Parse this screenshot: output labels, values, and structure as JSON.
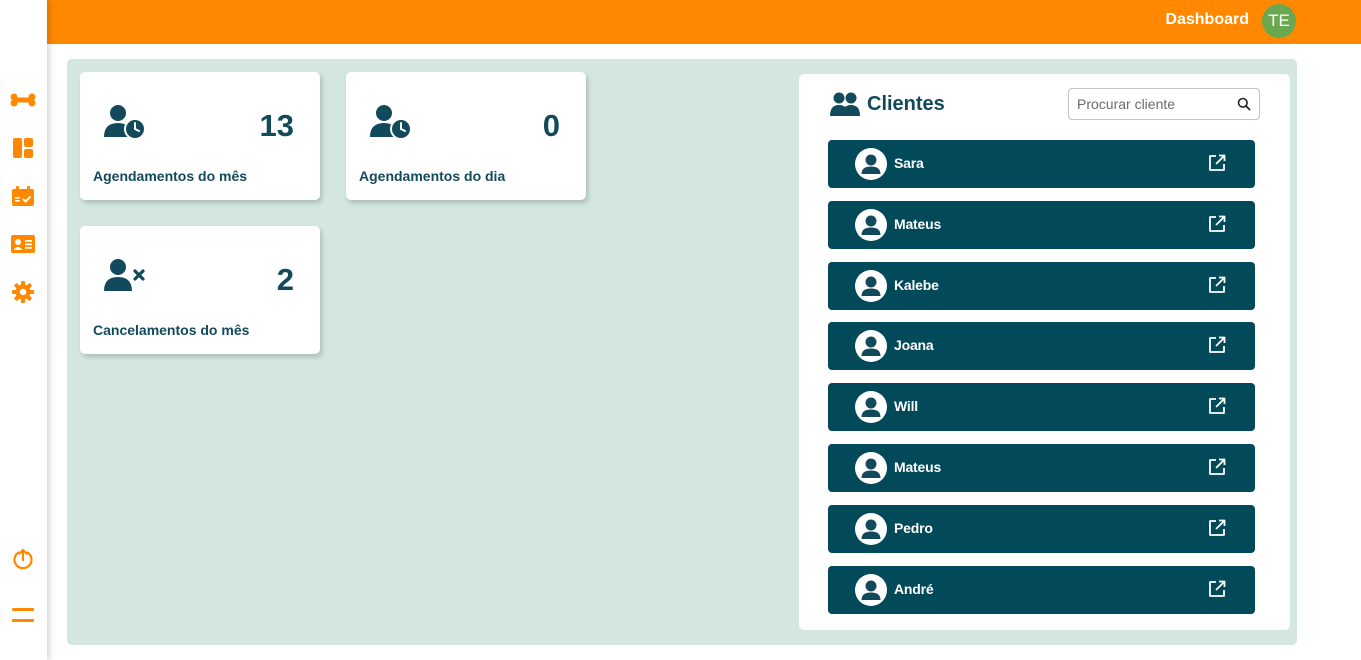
{
  "header": {
    "title": "Dashboard",
    "user_initials": "TE"
  },
  "sidebar": {
    "items": [
      {
        "icon": "bone-icon"
      },
      {
        "icon": "dashboard-icon"
      },
      {
        "icon": "calendar-check-icon"
      },
      {
        "icon": "id-card-icon"
      },
      {
        "icon": "gear-icon"
      }
    ],
    "bottom": [
      {
        "icon": "logout-icon"
      },
      {
        "icon": "menu-icon"
      }
    ]
  },
  "stats": [
    {
      "icon": "user-clock-icon",
      "value": "13",
      "label": "Agendamentos do mês"
    },
    {
      "icon": "user-clock-icon",
      "value": "0",
      "label": "Agendamentos do dia"
    },
    {
      "icon": "user-xmark-icon",
      "value": "2",
      "label": "Cancelamentos do mês"
    }
  ],
  "clients": {
    "title": "Clientes",
    "search_placeholder": "Procurar cliente",
    "list": [
      {
        "name": "Sara"
      },
      {
        "name": "Mateus"
      },
      {
        "name": "Kalebe"
      },
      {
        "name": "Joana"
      },
      {
        "name": "Will"
      },
      {
        "name": "Mateus"
      },
      {
        "name": "Pedro"
      },
      {
        "name": "André"
      }
    ]
  },
  "colors": {
    "accent": "#ff8800",
    "primary": "#024959",
    "panel_background": "#d3e6e0",
    "avatar": "#6aa84f"
  }
}
